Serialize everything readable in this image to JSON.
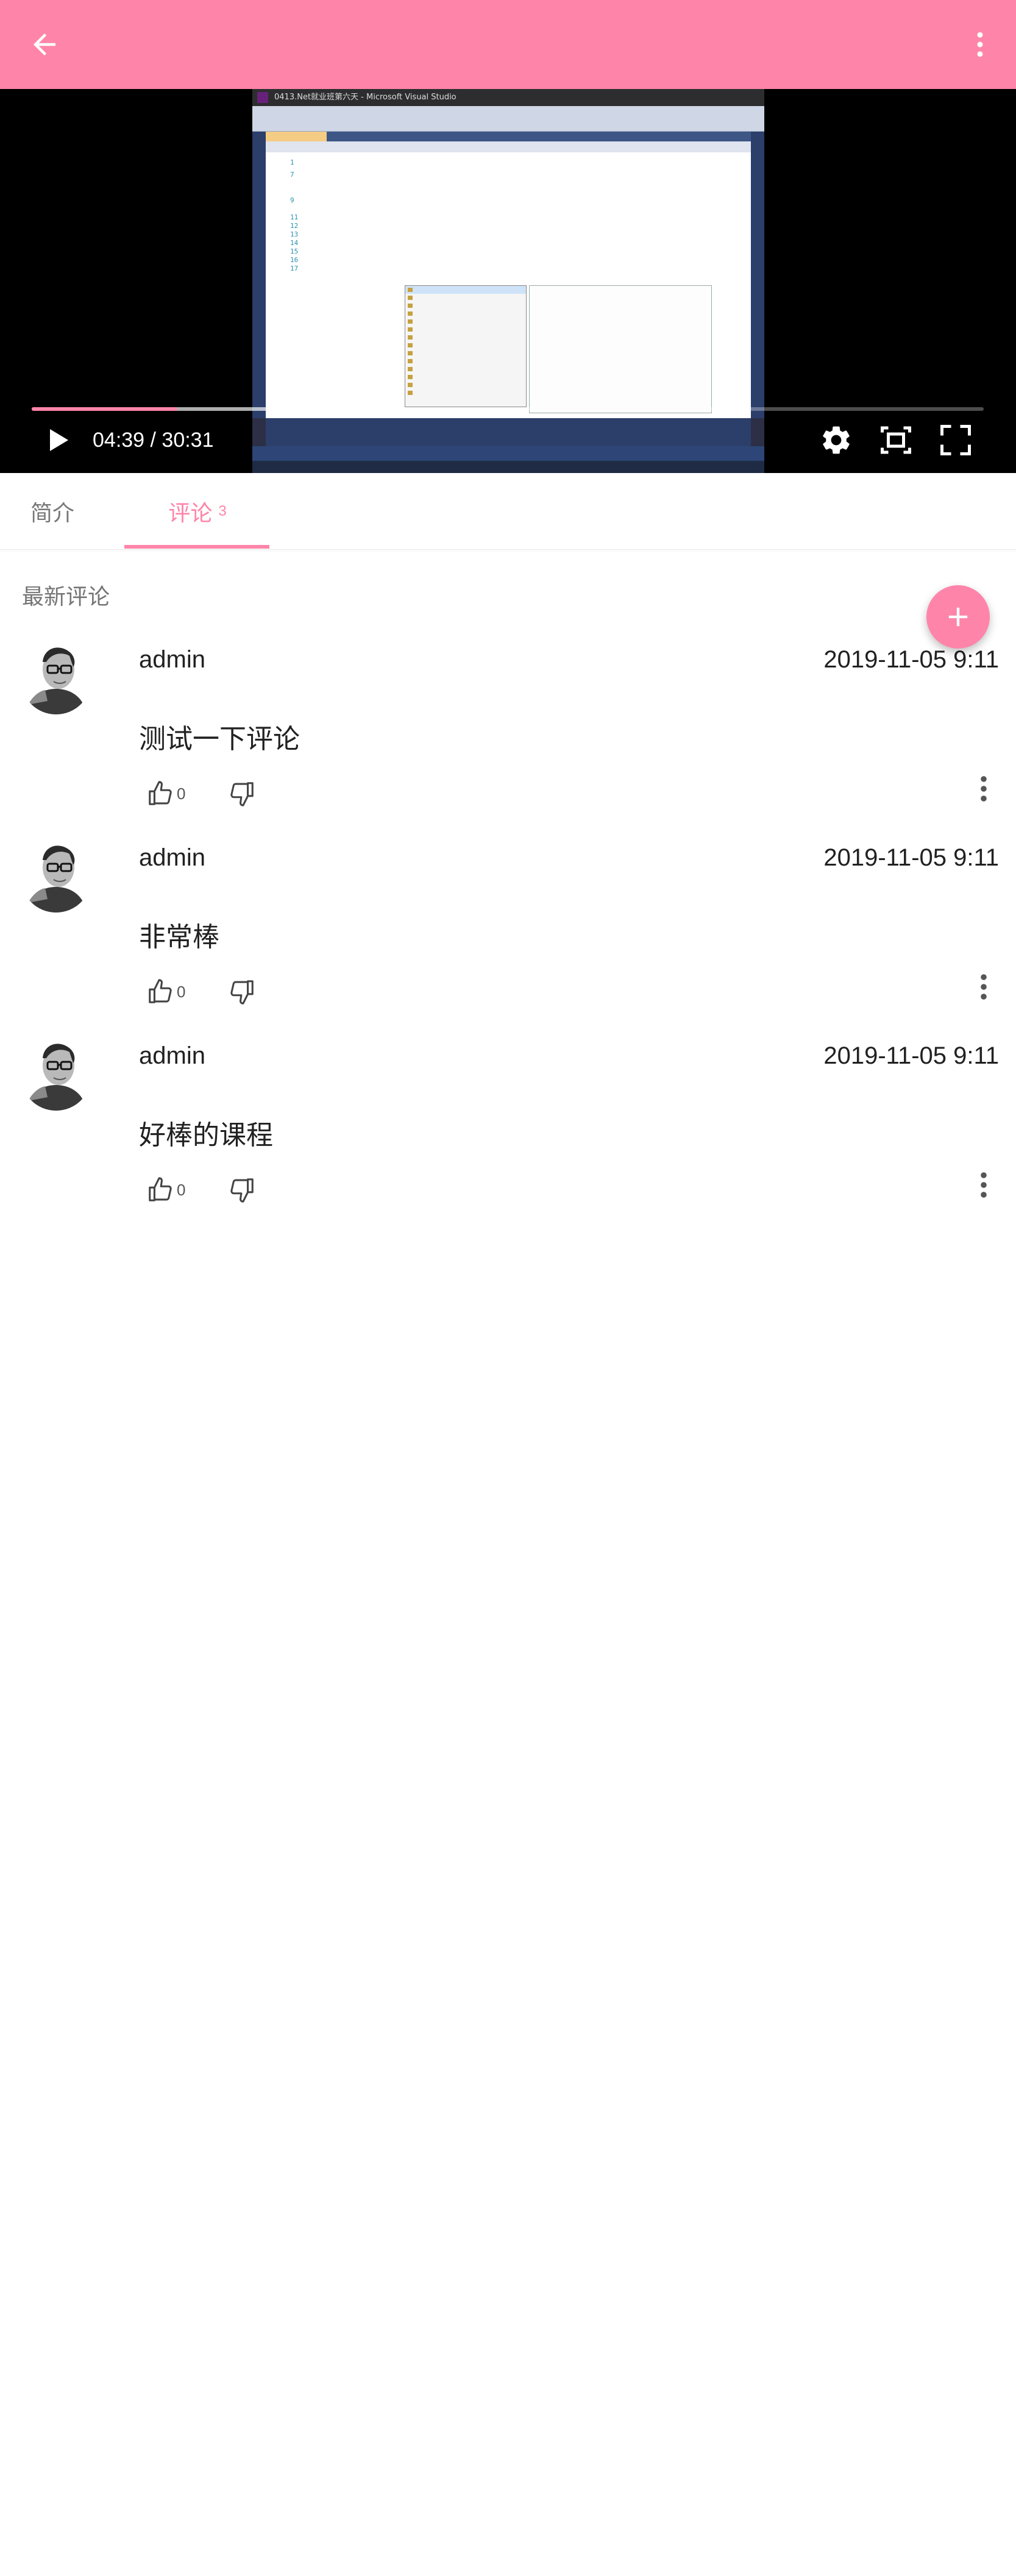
{
  "appbar": {
    "back_icon": "arrow-left-icon",
    "more_icon": "more-vertical-icon",
    "background": "#fe85a9"
  },
  "player": {
    "time_label": "04:39 / 30:31",
    "progress_fraction": 0.153,
    "buffered_fraction": 0.4,
    "window_title": "0413.Net就业班第六天 - Microsoft Visual Studio",
    "controls": [
      "play-icon",
      "settings-icon",
      "picture-in-picture-icon",
      "fullscreen-icon"
    ]
  },
  "tabs": {
    "intro_label": "简介",
    "comments_label": "评论",
    "comments_count": "3",
    "active": "comments",
    "accent": "#fe85a9"
  },
  "comments": {
    "section_title": "最新评论",
    "fab_icon": "plus-icon",
    "items": [
      {
        "user": "admin",
        "date": "2019-11-05 9:11",
        "text": "测试一下评论",
        "likes": "0"
      },
      {
        "user": "admin",
        "date": "2019-11-05 9:11",
        "text": "非常棒",
        "likes": "0"
      },
      {
        "user": "admin",
        "date": "2019-11-05 9:11",
        "text": "好棒的课程",
        "likes": "0"
      }
    ]
  }
}
